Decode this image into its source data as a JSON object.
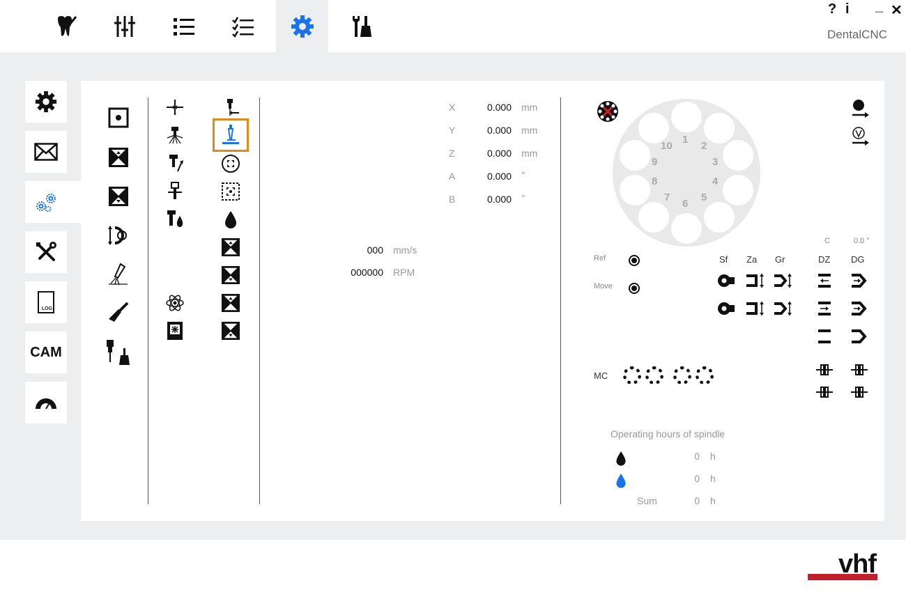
{
  "window": {
    "app_title": "DentalCNC",
    "help_label": "?",
    "info_label": "i",
    "minimize_label": "_",
    "close_label": "✕"
  },
  "top_tabs": [
    {
      "icon": "tooth-icon",
      "active": false
    },
    {
      "icon": "sliders-icon",
      "active": false
    },
    {
      "icon": "list-icon",
      "active": false
    },
    {
      "icon": "checklist-icon",
      "active": false
    },
    {
      "icon": "gear-icon",
      "active": true
    },
    {
      "icon": "service-tools-icon",
      "active": false
    }
  ],
  "sidebar": {
    "items": [
      {
        "icon": "gear-icon",
        "label": ""
      },
      {
        "icon": "envelope-icon",
        "label": ""
      },
      {
        "icon": "gears-icon",
        "label": "",
        "active": true
      },
      {
        "icon": "wrench-screwdriver-icon",
        "label": ""
      },
      {
        "icon": "log-file-icon",
        "label": "LOG"
      },
      {
        "icon": "cam-icon",
        "label": "CAM"
      },
      {
        "icon": "protractor-icon",
        "label": ""
      }
    ]
  },
  "axes": [
    {
      "name": "X",
      "value": "0.000",
      "unit": "mm"
    },
    {
      "name": "Y",
      "value": "0.000",
      "unit": "mm"
    },
    {
      "name": "Z",
      "value": "0.000",
      "unit": "mm"
    },
    {
      "name": "A",
      "value": "0.000",
      "unit": "°"
    },
    {
      "name": "B",
      "value": "0.000",
      "unit": "°"
    }
  ],
  "feed": {
    "value": "000",
    "unit": "mm/s"
  },
  "spindle_speed": {
    "value": "000000",
    "unit": "RPM"
  },
  "tool_changer": {
    "slots": [
      "1",
      "2",
      "3",
      "4",
      "5",
      "6",
      "7",
      "8",
      "9",
      "10"
    ],
    "c_label": "C",
    "c_value": "0.0 °"
  },
  "labels": {
    "ref": "Ref",
    "move": "Move",
    "mc": "MC",
    "sf": "Sf",
    "za": "Za",
    "gr": "Gr",
    "dz": "DZ",
    "dg": "DG"
  },
  "operating_hours": {
    "title": "Operating hours of spindle",
    "rows": [
      {
        "icon": "drop-black-icon",
        "label": "",
        "value": "0",
        "unit": "h"
      },
      {
        "icon": "drop-blue-icon",
        "label": "",
        "value": "0",
        "unit": "h"
      },
      {
        "icon": "",
        "label": "Sum",
        "value": "0",
        "unit": "h"
      }
    ]
  },
  "brand": {
    "logo_text": "vhf",
    "accent": "#c0202a"
  },
  "colors": {
    "active_blue": "#1a73e8",
    "highlight_orange": "#e08a1e"
  }
}
